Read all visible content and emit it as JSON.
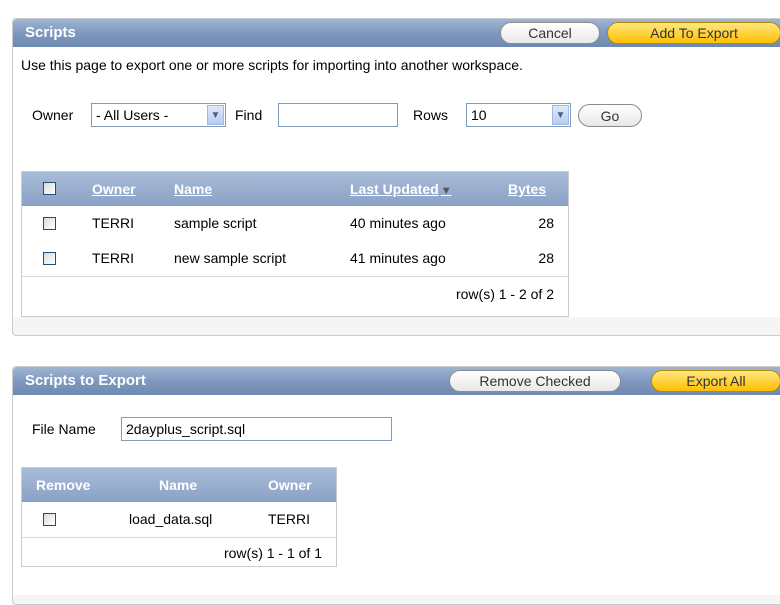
{
  "scripts_region": {
    "title": "Scripts",
    "cancel_label": "Cancel",
    "add_label": "Add To Export",
    "description": "Use this page to export one or more scripts for importing into another workspace.",
    "owner_label": "Owner",
    "owner_value": "- All Users -",
    "find_label": "Find",
    "find_value": "",
    "rows_label": "Rows",
    "rows_value": "10",
    "go_label": "Go",
    "columns": {
      "owner": "Owner",
      "name": "Name",
      "last_updated": "Last Updated",
      "bytes": "Bytes"
    },
    "sort_icon": "▼",
    "rows": [
      {
        "owner": "TERRI",
        "name": "sample script",
        "updated": "40 minutes ago",
        "bytes": "28"
      },
      {
        "owner": "TERRI",
        "name": "new sample script",
        "updated": "41 minutes ago",
        "bytes": "28"
      }
    ],
    "pagination": "row(s) 1 - 2 of 2"
  },
  "export_region": {
    "title": "Scripts to Export",
    "remove_label": "Remove Checked",
    "export_label": "Export All",
    "file_name_label": "File Name",
    "file_name_value": "2dayplus_script.sql",
    "columns": {
      "remove": "Remove",
      "name": "Name",
      "owner": "Owner"
    },
    "rows": [
      {
        "name": "load_data.sql",
        "owner": "TERRI"
      }
    ],
    "pagination": "row(s) 1 - 1 of 1"
  },
  "icons": {
    "dropdown": "chevron-down-icon",
    "checkbox": "checkbox-icon",
    "sort": "sort-descending-icon"
  },
  "colors": {
    "header": "#7f98bd",
    "primary_button": "#ffc000"
  }
}
